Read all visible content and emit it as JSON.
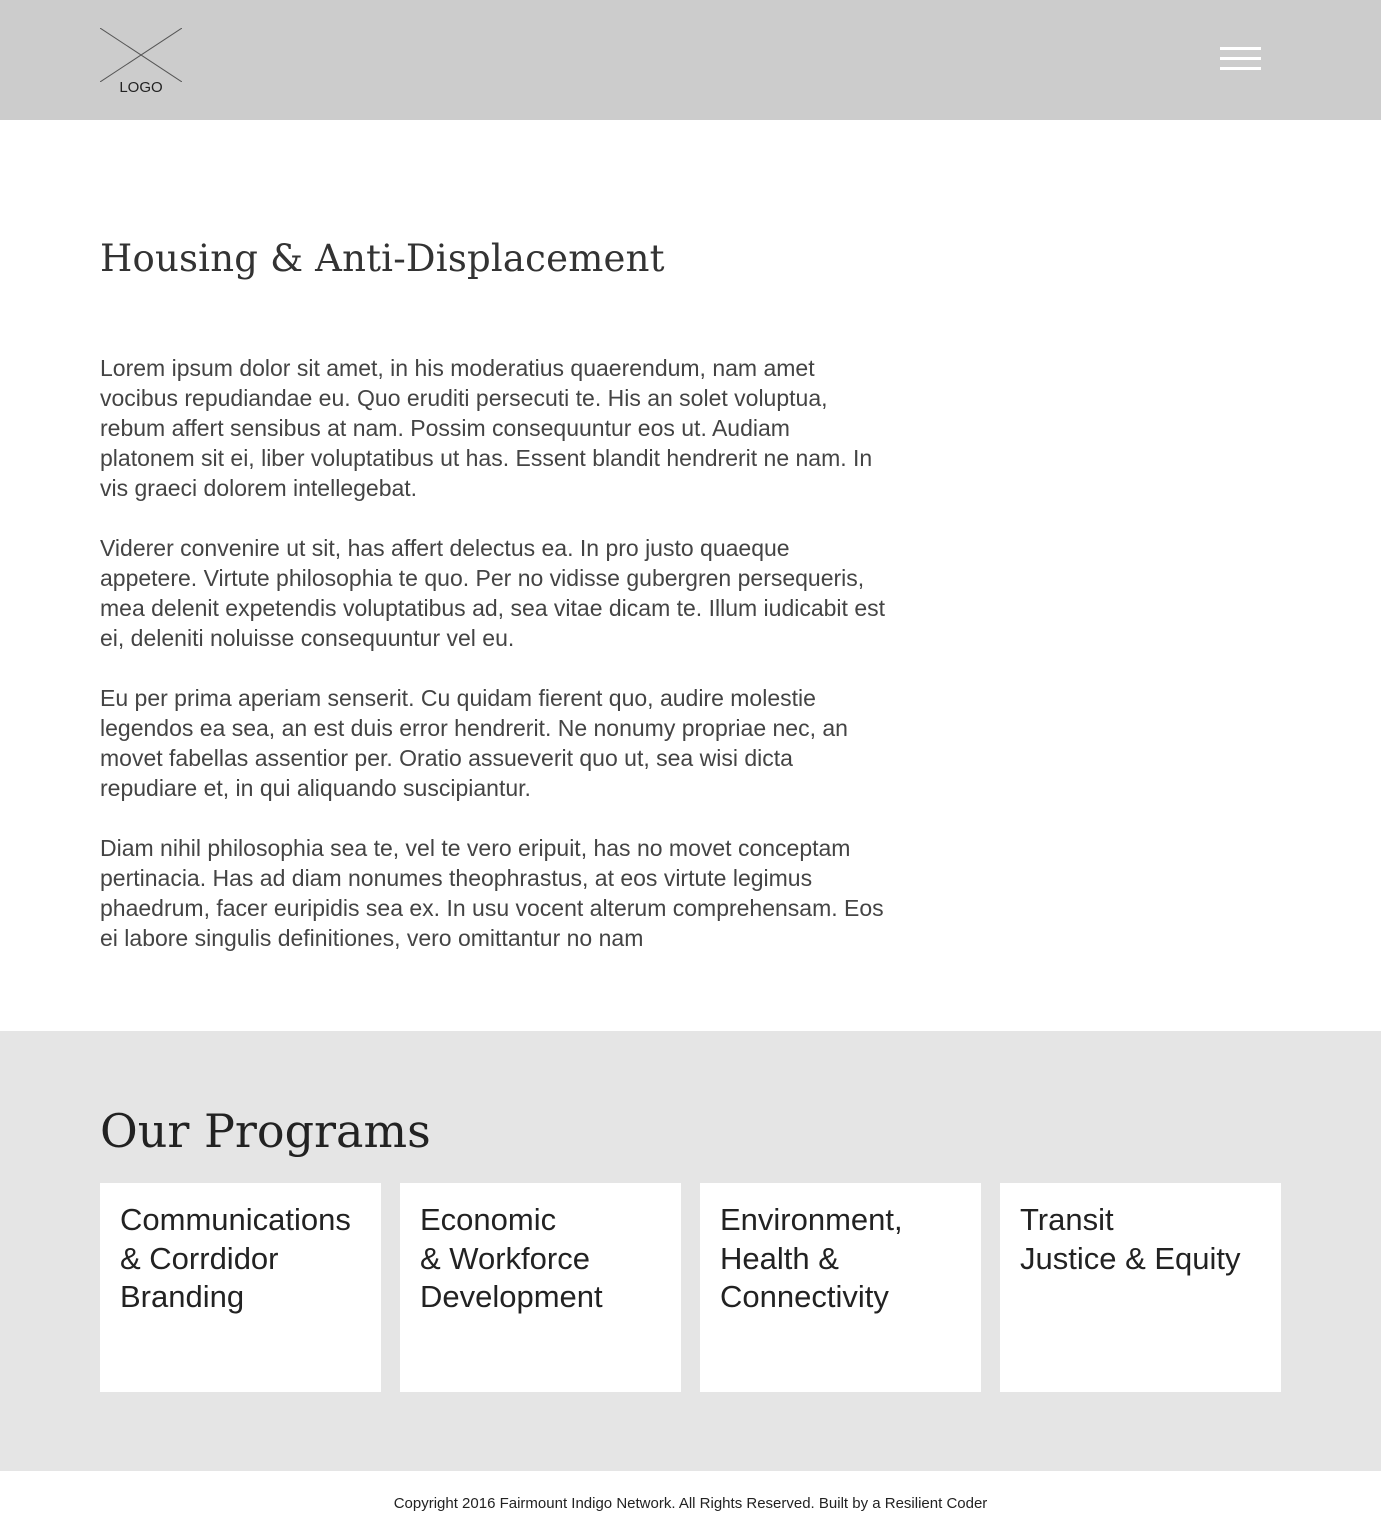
{
  "header": {
    "logo_label": "LOGO"
  },
  "main": {
    "title": "Housing & Anti-Displacement",
    "paragraphs": [
      "Lorem ipsum dolor sit amet, in his moderatius quaerendum, nam amet vocibus repudiandae eu. Quo eruditi persecuti te. His an solet voluptua, rebum affert sensibus at nam. Possim consequuntur eos ut. Audiam platonem sit ei, liber voluptatibus ut has. Essent blandit hendrerit ne nam. In vis graeci dolorem intellegebat.",
      "Viderer convenire ut sit, has affert delectus ea. In pro justo quaeque appetere. Virtute philosophia te quo. Per no vidisse gubergren persequeris, mea delenit expetendis voluptatibus ad, sea vitae dicam te. Illum iudicabit est ei, deleniti noluisse consequuntur vel eu.",
      "Eu per prima aperiam senserit. Cu quidam fierent quo, audire molestie legendos ea sea, an est duis error hendrerit. Ne nonumy propriae nec, an movet fabellas assentior per. Oratio assueverit quo ut, sea wisi dicta repudiare et, in qui aliquando suscipiantur.",
      "Diam nihil philosophia sea te, vel te vero eripuit, has no movet conceptam pertinacia. Has ad diam nonumes theophrastus, at eos virtute legimus phaedrum, facer euripidis sea ex. In usu vocent alterum comprehensam. Eos ei labore singulis definitiones, vero omittantur no nam"
    ]
  },
  "programs": {
    "title": "Our Programs",
    "cards": [
      {
        "lines": [
          "Communications",
          "& Corrdidor",
          "Branding"
        ]
      },
      {
        "lines": [
          "Economic",
          "& Workforce",
          "Development"
        ]
      },
      {
        "lines": [
          "Environment,",
          "Health &",
          "Connectivity"
        ]
      },
      {
        "lines": [
          "Transit",
          "Justice & Equity",
          ""
        ]
      }
    ]
  },
  "footer": {
    "text": "Copyright 2016 Fairmount Indigo Network. All Rights Reserved. Built by a Resilient Coder"
  },
  "colors": {
    "header_bg": "#cccccc",
    "programs_bg": "#e5e5e5",
    "card_bg": "#ffffff",
    "text": "#333333"
  },
  "icons": {
    "logo": "logo-placeholder-icon",
    "menu": "hamburger-menu-icon"
  }
}
